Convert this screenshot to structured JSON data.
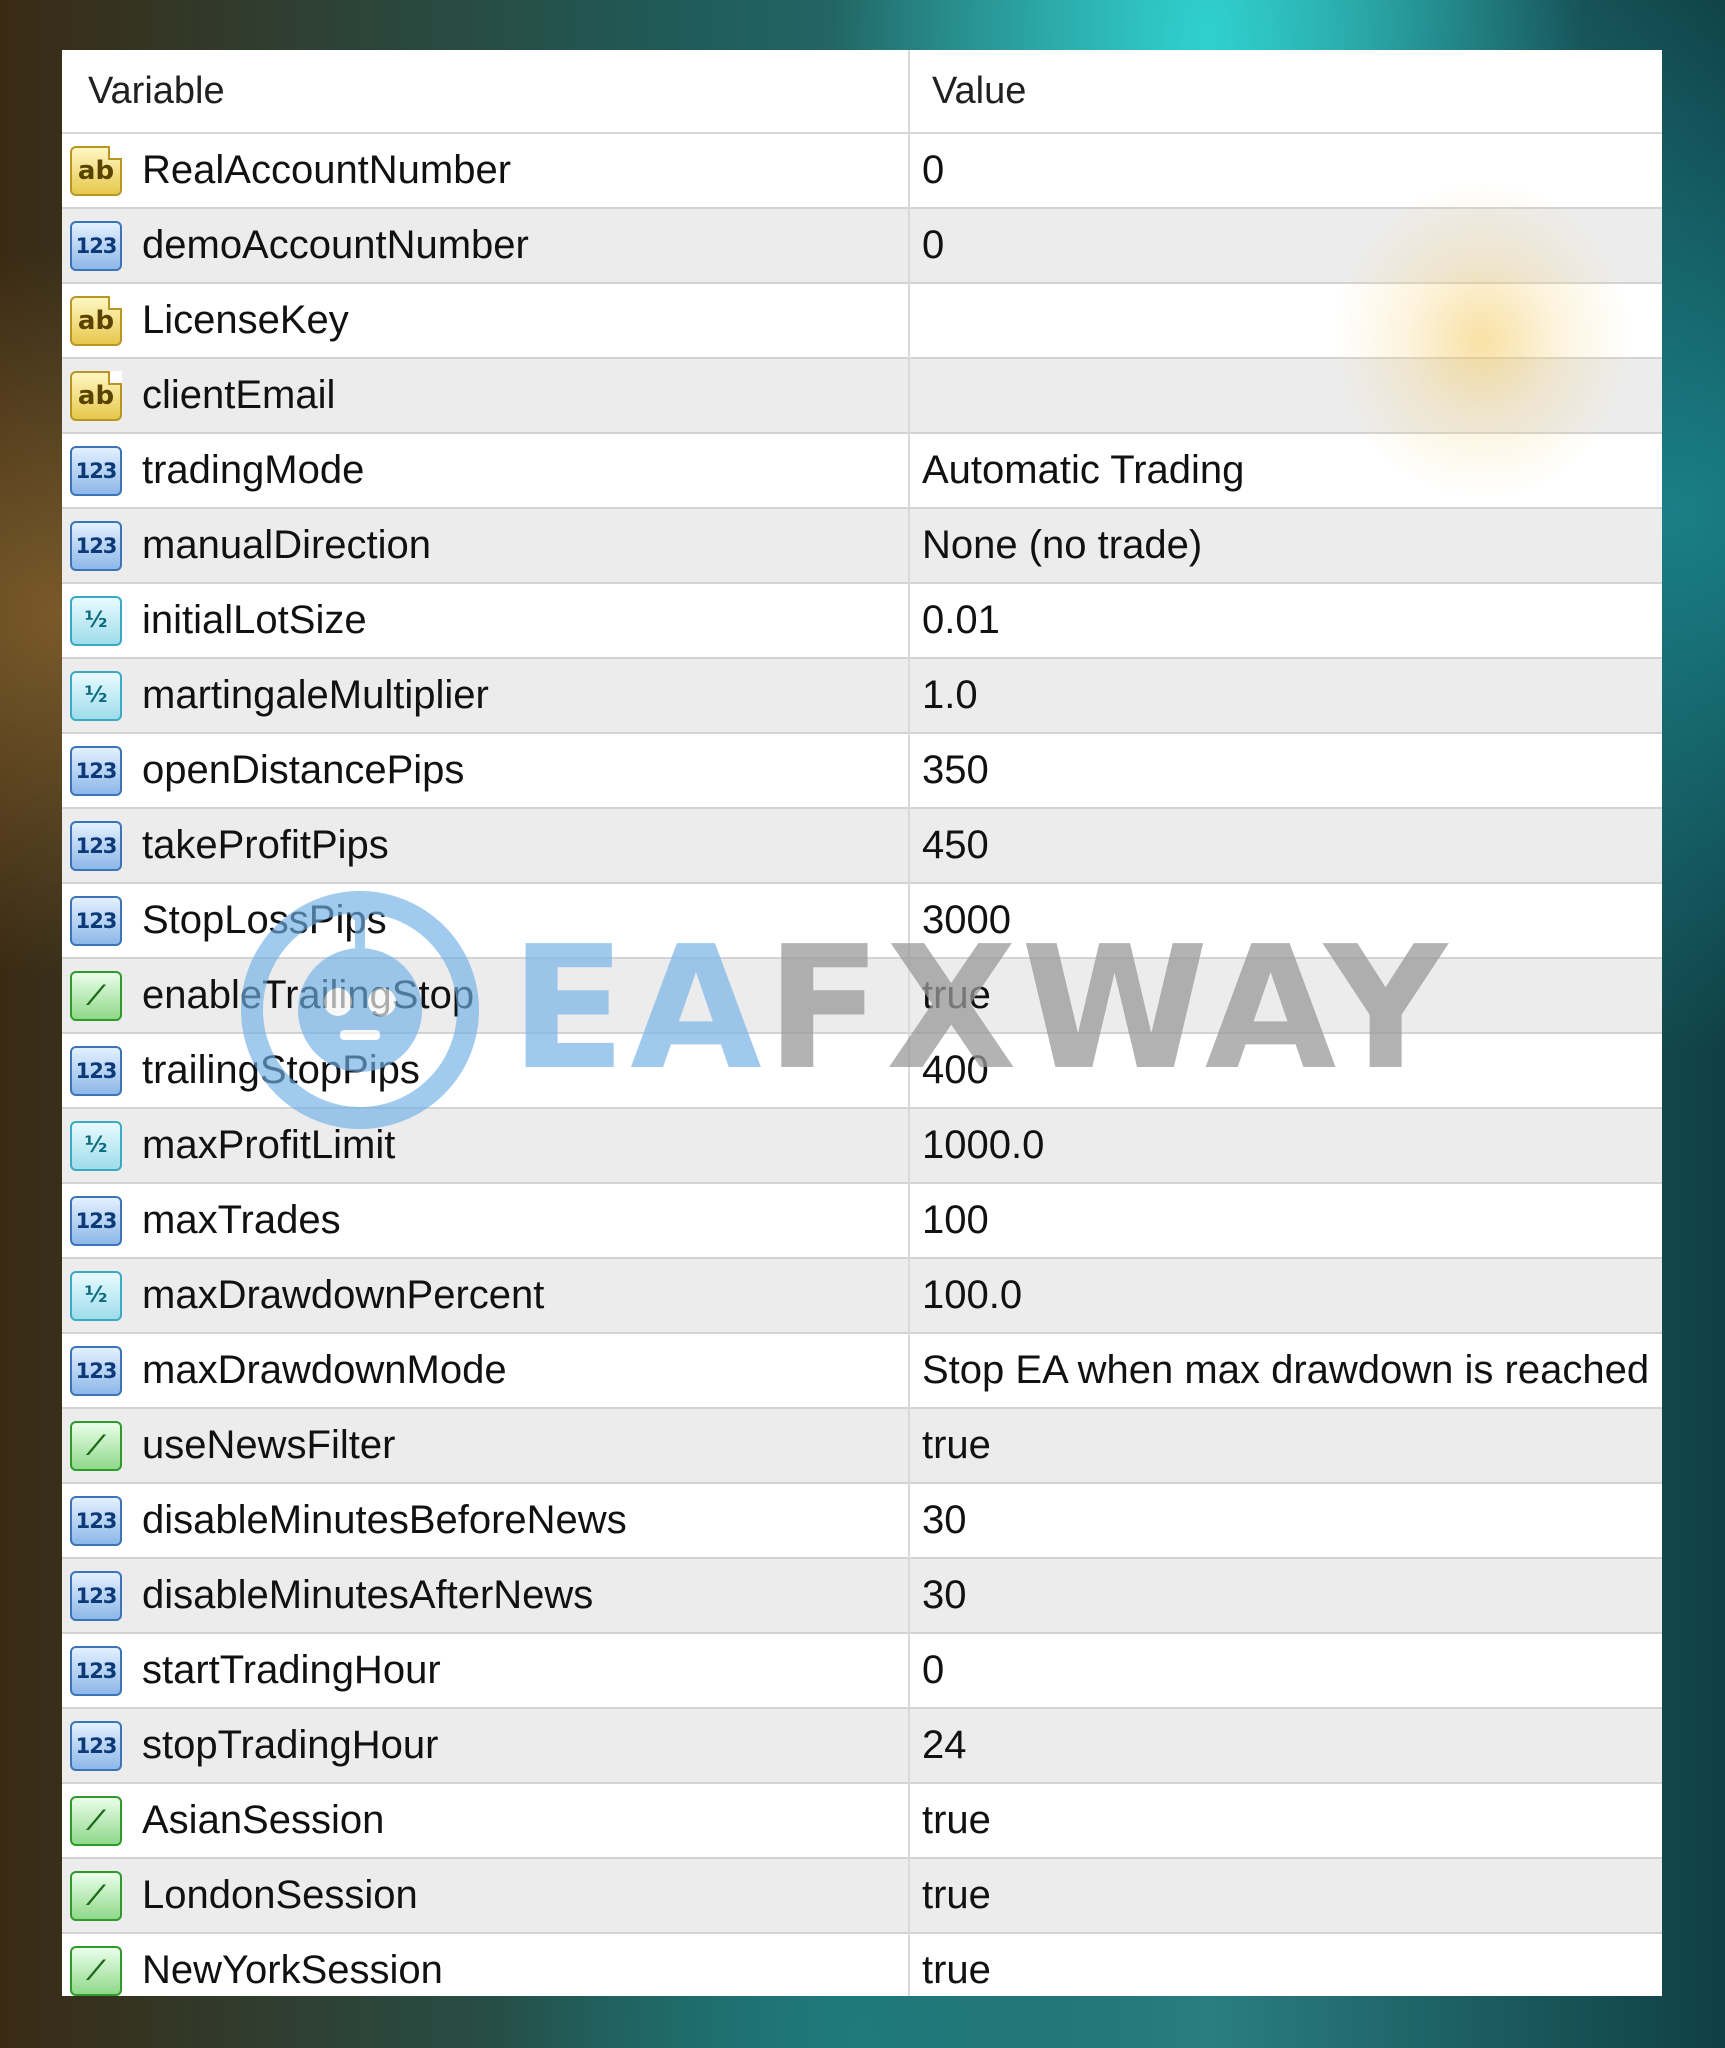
{
  "header": {
    "variable": "Variable",
    "value": "Value"
  },
  "watermark": {
    "ea": "EA",
    "fxway": "FXWAY"
  },
  "rows": [
    {
      "icon": "ab",
      "name": "RealAccountNumber",
      "value": "0"
    },
    {
      "icon": "123",
      "name": "demoAccountNumber",
      "value": "0"
    },
    {
      "icon": "ab",
      "name": "LicenseKey",
      "value": ""
    },
    {
      "icon": "ab",
      "name": "clientEmail",
      "value": ""
    },
    {
      "icon": "123",
      "name": "tradingMode",
      "value": "Automatic Trading"
    },
    {
      "icon": "123",
      "name": "manualDirection",
      "value": "None (no trade)"
    },
    {
      "icon": "v2",
      "name": "initialLotSize",
      "value": "0.01"
    },
    {
      "icon": "v2",
      "name": "martingaleMultiplier",
      "value": "1.0"
    },
    {
      "icon": "123",
      "name": "openDistancePips",
      "value": "350"
    },
    {
      "icon": "123",
      "name": "takeProfitPips",
      "value": "450"
    },
    {
      "icon": "123",
      "name": "StopLossPips",
      "value": "3000"
    },
    {
      "icon": "bool",
      "name": "enableTrailingStop",
      "value": "true"
    },
    {
      "icon": "123",
      "name": "trailingStopPips",
      "value": "400"
    },
    {
      "icon": "v2",
      "name": "maxProfitLimit",
      "value": "1000.0"
    },
    {
      "icon": "123",
      "name": "maxTrades",
      "value": "100"
    },
    {
      "icon": "v2",
      "name": "maxDrawdownPercent",
      "value": "100.0"
    },
    {
      "icon": "123",
      "name": "maxDrawdownMode",
      "value": "Stop EA when max drawdown is reached"
    },
    {
      "icon": "bool",
      "name": "useNewsFilter",
      "value": "true"
    },
    {
      "icon": "123",
      "name": "disableMinutesBeforeNews",
      "value": "30"
    },
    {
      "icon": "123",
      "name": "disableMinutesAfterNews",
      "value": "30"
    },
    {
      "icon": "123",
      "name": "startTradingHour",
      "value": "0"
    },
    {
      "icon": "123",
      "name": "stopTradingHour",
      "value": "24"
    },
    {
      "icon": "bool",
      "name": "AsianSession",
      "value": "true"
    },
    {
      "icon": "bool",
      "name": "LondonSession",
      "value": "true"
    },
    {
      "icon": "bool",
      "name": "NewYorkSession",
      "value": "true"
    }
  ]
}
